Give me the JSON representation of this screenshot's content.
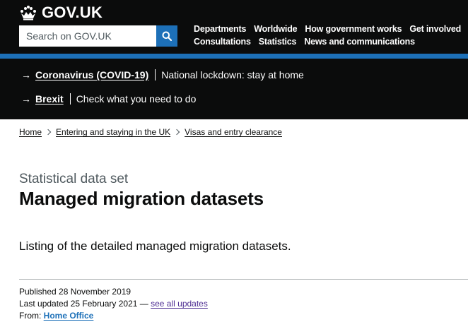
{
  "header": {
    "logo_text": "GOV.UK",
    "search_placeholder": "Search on GOV.UK",
    "nav_row1": [
      "Departments",
      "Worldwide",
      "How government works",
      "Get involved"
    ],
    "nav_row2": [
      "Consultations",
      "Statistics",
      "News and communications"
    ]
  },
  "notices": [
    {
      "link": "Coronavirus (COVID-19)",
      "text": "National lockdown: stay at home"
    },
    {
      "link": "Brexit",
      "text": "Check what you need to do"
    }
  ],
  "breadcrumbs": [
    "Home",
    "Entering and staying in the UK",
    "Visas and entry clearance"
  ],
  "page": {
    "caption": "Statistical data set",
    "title": "Managed migration datasets",
    "lead": "Listing of the detailed managed migration datasets."
  },
  "metadata": {
    "published": "Published 28 November 2019",
    "updated_prefix": "Last updated 25 February 2021 — ",
    "updated_link": "see all updates",
    "from_prefix": "From: ",
    "from_link": "Home Office"
  },
  "colors": {
    "header_bg": "#0b0c0c",
    "brand_blue": "#1d70b8",
    "visited_link": "#4c2c92",
    "secondary_text": "#505a5f"
  }
}
